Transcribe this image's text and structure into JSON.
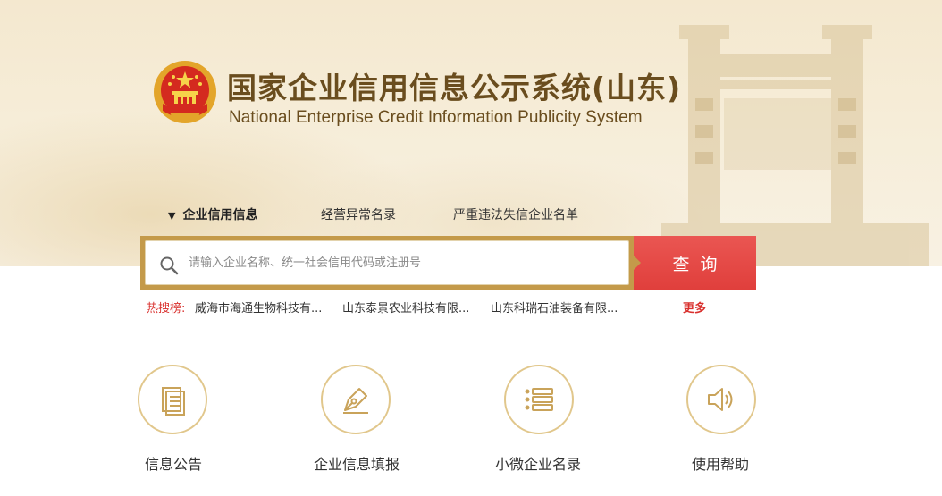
{
  "header": {
    "title_cn": "国家企业信用信息公示系统(山东)",
    "title_en": "National Enterprise Credit Information Publicity System"
  },
  "tabs": [
    {
      "label": "企业信用信息",
      "active": true
    },
    {
      "label": "经营异常名录",
      "active": false
    },
    {
      "label": "严重违法失信企业名单",
      "active": false
    }
  ],
  "search": {
    "placeholder": "请输入企业名称、统一社会信用代码或注册号",
    "value": "",
    "button_label": "查询"
  },
  "hot": {
    "label": "热搜榜:",
    "items": [
      "威海市海通生物科技有...",
      "山东泰景农业科技有限...",
      "山东科瑞石油装备有限..."
    ],
    "more_label": "更多"
  },
  "features": [
    {
      "label": "信息公告",
      "icon": "document-icon"
    },
    {
      "label": "企业信息填报",
      "icon": "pen-nib-icon"
    },
    {
      "label": "小微企业名录",
      "icon": "list-icon"
    },
    {
      "label": "使用帮助",
      "icon": "speaker-icon"
    }
  ],
  "colors": {
    "accent_gold": "#c49a4a",
    "title_brown": "#6a4d1e",
    "button_red": "#e5504d",
    "hot_red": "#d9312e",
    "icon_gold": "#e1c78c"
  }
}
